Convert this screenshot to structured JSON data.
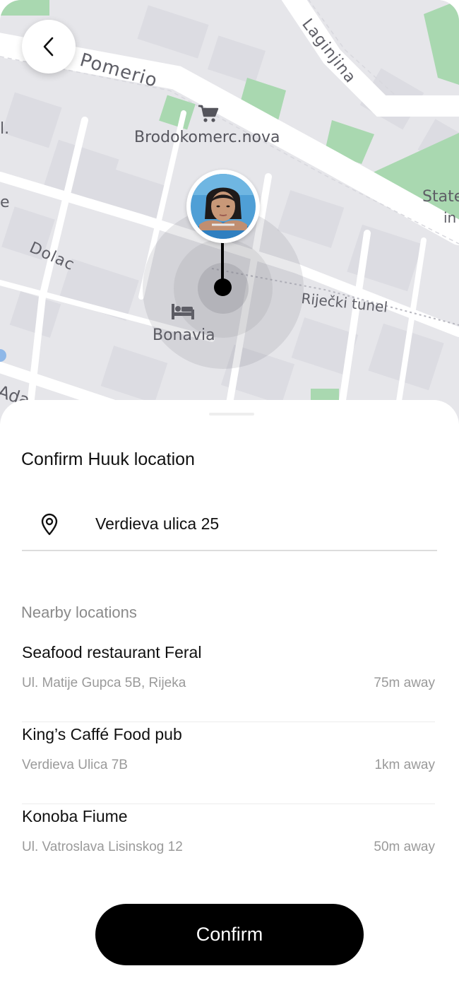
{
  "map": {
    "labels": {
      "pomerio": "Pomerio",
      "laginjina": "Laginjina",
      "poi_store": "Brodokomerc.nova",
      "dolac": "Dolac",
      "tunnel": "Riječki tunel",
      "poi_hotel": "Bonavia",
      "edge_state": "State",
      "edge_in": "in",
      "edge_l": "l.",
      "edge_e": "e",
      "edge_ada": "Ada"
    },
    "icons": {
      "back": "chevron-left-icon",
      "store": "shopping-cart-icon",
      "hotel": "bed-icon"
    },
    "colors": {
      "land": "#e6e6ea",
      "road": "#ffffff",
      "park": "#a9d8b0",
      "pin": "#000000"
    }
  },
  "sheet": {
    "title": "Confirm Huuk location",
    "address": {
      "icon": "location-pin-icon",
      "value": "Verdieva ulica 25"
    },
    "nearby_heading": "Nearby locations",
    "locations": [
      {
        "name": "Seafood restaurant Feral",
        "address": "Ul. Matije Gupca 5B, Rijeka",
        "distance": "75m away"
      },
      {
        "name": "King’s Caffé Food pub",
        "address": "Verdieva Ulica 7B",
        "distance": "1km away"
      },
      {
        "name": "Konoba Fiume",
        "address": "Ul. Vatroslava Lisinskog 12",
        "distance": "50m away"
      }
    ],
    "confirm_label": "Confirm",
    "button_color": "#000000"
  }
}
